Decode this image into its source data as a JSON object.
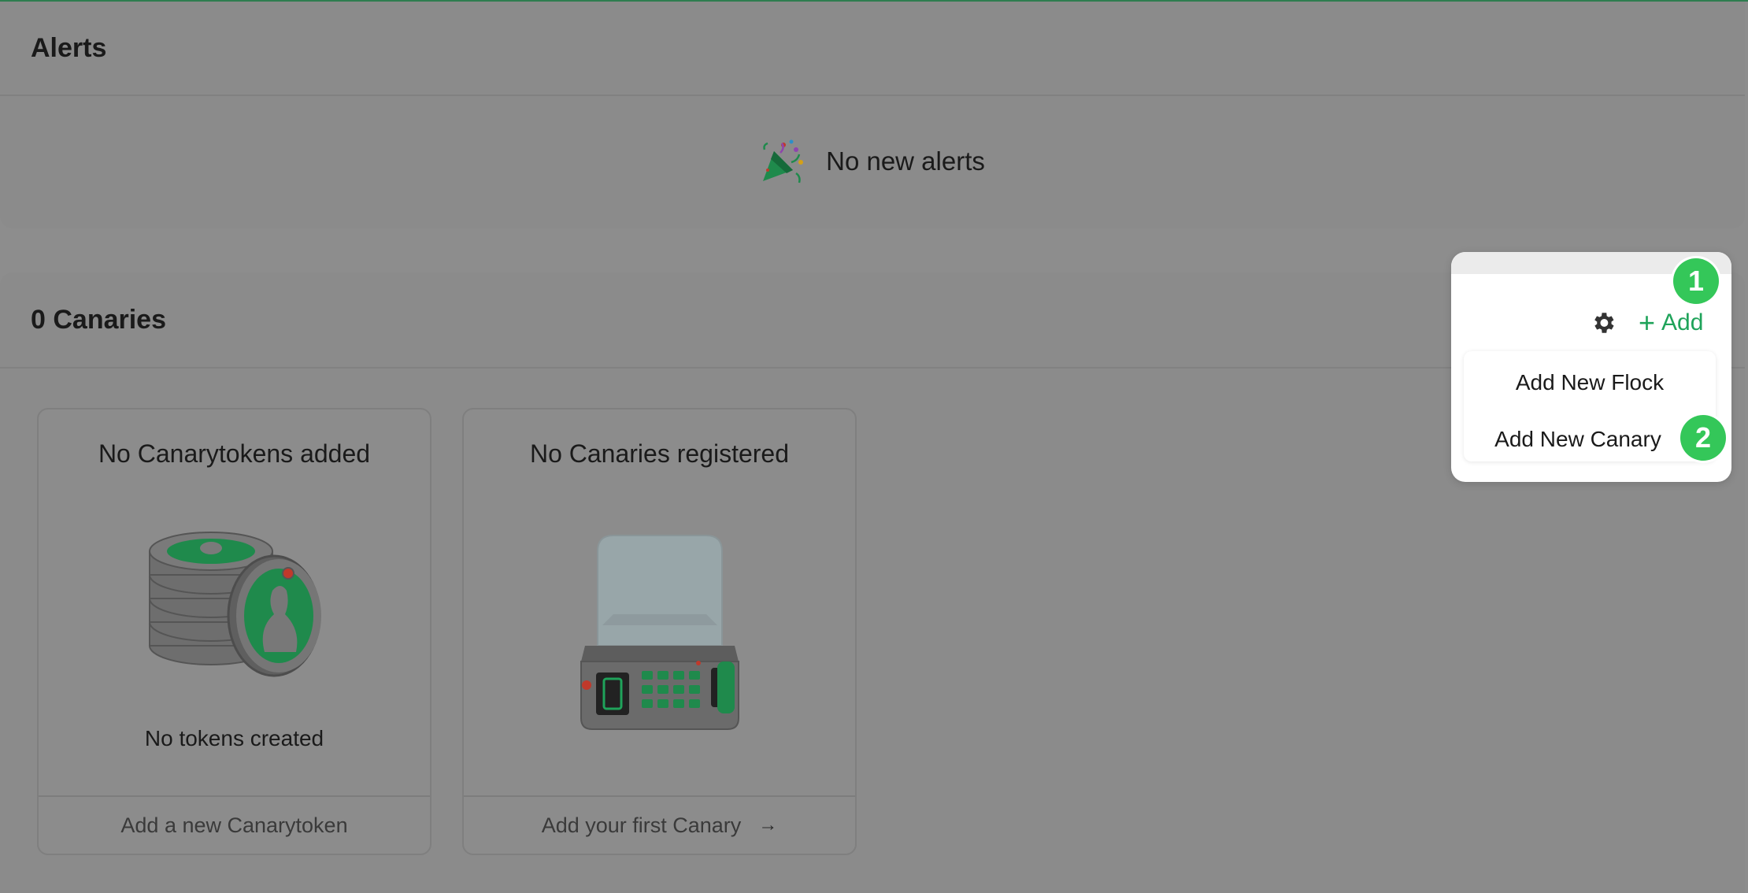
{
  "alerts": {
    "title": "Alerts",
    "empty_message": "No new alerts",
    "empty_icon": "party-popper-icon"
  },
  "canaries": {
    "title": "0 Canaries",
    "cards": [
      {
        "title": "No Canarytokens added",
        "illustration": "canarytoken-coins-icon",
        "subtext": "No tokens created",
        "action_label": "Add a new Canarytoken"
      },
      {
        "title": "No Canaries registered",
        "illustration": "canary-device-icon",
        "action_label": "Add your first Canary",
        "action_icon": "arrow-right-icon"
      }
    ]
  },
  "toolbar": {
    "settings_icon": "gear-icon",
    "add_label": "Add",
    "add_icon": "plus-icon"
  },
  "add_menu": {
    "items": [
      {
        "label": "Add New Flock"
      },
      {
        "label": "Add New Canary"
      }
    ]
  },
  "step_badges": [
    "1",
    "2"
  ],
  "colors": {
    "accent": "#1fa35a",
    "badge": "#34c759",
    "overlay": "#8d8d8d",
    "popover_bg": "#ffffff"
  }
}
